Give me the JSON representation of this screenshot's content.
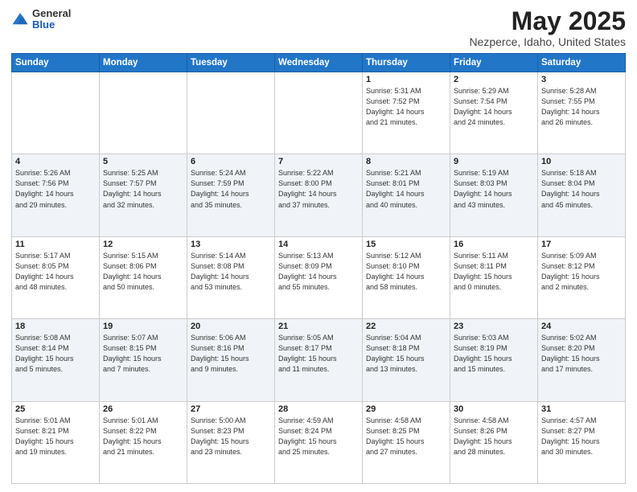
{
  "header": {
    "logo_general": "General",
    "logo_blue": "Blue",
    "title": "May 2025",
    "location": "Nezperce, Idaho, United States"
  },
  "days_of_week": [
    "Sunday",
    "Monday",
    "Tuesday",
    "Wednesday",
    "Thursday",
    "Friday",
    "Saturday"
  ],
  "weeks": [
    [
      {
        "day": "",
        "info": ""
      },
      {
        "day": "",
        "info": ""
      },
      {
        "day": "",
        "info": ""
      },
      {
        "day": "",
        "info": ""
      },
      {
        "day": "1",
        "info": "Sunrise: 5:31 AM\nSunset: 7:52 PM\nDaylight: 14 hours\nand 21 minutes."
      },
      {
        "day": "2",
        "info": "Sunrise: 5:29 AM\nSunset: 7:54 PM\nDaylight: 14 hours\nand 24 minutes."
      },
      {
        "day": "3",
        "info": "Sunrise: 5:28 AM\nSunset: 7:55 PM\nDaylight: 14 hours\nand 26 minutes."
      }
    ],
    [
      {
        "day": "4",
        "info": "Sunrise: 5:26 AM\nSunset: 7:56 PM\nDaylight: 14 hours\nand 29 minutes."
      },
      {
        "day": "5",
        "info": "Sunrise: 5:25 AM\nSunset: 7:57 PM\nDaylight: 14 hours\nand 32 minutes."
      },
      {
        "day": "6",
        "info": "Sunrise: 5:24 AM\nSunset: 7:59 PM\nDaylight: 14 hours\nand 35 minutes."
      },
      {
        "day": "7",
        "info": "Sunrise: 5:22 AM\nSunset: 8:00 PM\nDaylight: 14 hours\nand 37 minutes."
      },
      {
        "day": "8",
        "info": "Sunrise: 5:21 AM\nSunset: 8:01 PM\nDaylight: 14 hours\nand 40 minutes."
      },
      {
        "day": "9",
        "info": "Sunrise: 5:19 AM\nSunset: 8:03 PM\nDaylight: 14 hours\nand 43 minutes."
      },
      {
        "day": "10",
        "info": "Sunrise: 5:18 AM\nSunset: 8:04 PM\nDaylight: 14 hours\nand 45 minutes."
      }
    ],
    [
      {
        "day": "11",
        "info": "Sunrise: 5:17 AM\nSunset: 8:05 PM\nDaylight: 14 hours\nand 48 minutes."
      },
      {
        "day": "12",
        "info": "Sunrise: 5:15 AM\nSunset: 8:06 PM\nDaylight: 14 hours\nand 50 minutes."
      },
      {
        "day": "13",
        "info": "Sunrise: 5:14 AM\nSunset: 8:08 PM\nDaylight: 14 hours\nand 53 minutes."
      },
      {
        "day": "14",
        "info": "Sunrise: 5:13 AM\nSunset: 8:09 PM\nDaylight: 14 hours\nand 55 minutes."
      },
      {
        "day": "15",
        "info": "Sunrise: 5:12 AM\nSunset: 8:10 PM\nDaylight: 14 hours\nand 58 minutes."
      },
      {
        "day": "16",
        "info": "Sunrise: 5:11 AM\nSunset: 8:11 PM\nDaylight: 15 hours\nand 0 minutes."
      },
      {
        "day": "17",
        "info": "Sunrise: 5:09 AM\nSunset: 8:12 PM\nDaylight: 15 hours\nand 2 minutes."
      }
    ],
    [
      {
        "day": "18",
        "info": "Sunrise: 5:08 AM\nSunset: 8:14 PM\nDaylight: 15 hours\nand 5 minutes."
      },
      {
        "day": "19",
        "info": "Sunrise: 5:07 AM\nSunset: 8:15 PM\nDaylight: 15 hours\nand 7 minutes."
      },
      {
        "day": "20",
        "info": "Sunrise: 5:06 AM\nSunset: 8:16 PM\nDaylight: 15 hours\nand 9 minutes."
      },
      {
        "day": "21",
        "info": "Sunrise: 5:05 AM\nSunset: 8:17 PM\nDaylight: 15 hours\nand 11 minutes."
      },
      {
        "day": "22",
        "info": "Sunrise: 5:04 AM\nSunset: 8:18 PM\nDaylight: 15 hours\nand 13 minutes."
      },
      {
        "day": "23",
        "info": "Sunrise: 5:03 AM\nSunset: 8:19 PM\nDaylight: 15 hours\nand 15 minutes."
      },
      {
        "day": "24",
        "info": "Sunrise: 5:02 AM\nSunset: 8:20 PM\nDaylight: 15 hours\nand 17 minutes."
      }
    ],
    [
      {
        "day": "25",
        "info": "Sunrise: 5:01 AM\nSunset: 8:21 PM\nDaylight: 15 hours\nand 19 minutes."
      },
      {
        "day": "26",
        "info": "Sunrise: 5:01 AM\nSunset: 8:22 PM\nDaylight: 15 hours\nand 21 minutes."
      },
      {
        "day": "27",
        "info": "Sunrise: 5:00 AM\nSunset: 8:23 PM\nDaylight: 15 hours\nand 23 minutes."
      },
      {
        "day": "28",
        "info": "Sunrise: 4:59 AM\nSunset: 8:24 PM\nDaylight: 15 hours\nand 25 minutes."
      },
      {
        "day": "29",
        "info": "Sunrise: 4:58 AM\nSunset: 8:25 PM\nDaylight: 15 hours\nand 27 minutes."
      },
      {
        "day": "30",
        "info": "Sunrise: 4:58 AM\nSunset: 8:26 PM\nDaylight: 15 hours\nand 28 minutes."
      },
      {
        "day": "31",
        "info": "Sunrise: 4:57 AM\nSunset: 8:27 PM\nDaylight: 15 hours\nand 30 minutes."
      }
    ]
  ]
}
